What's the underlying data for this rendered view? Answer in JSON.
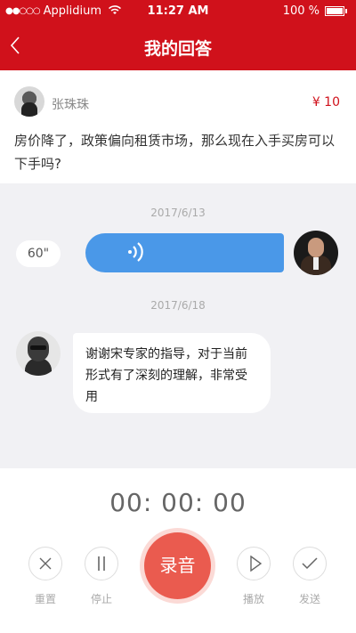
{
  "status_bar": {
    "carrier": "Applidium",
    "time": "11:27 AM",
    "battery": "100 %"
  },
  "nav": {
    "back_icon": "chevron-left-icon",
    "title": "我的回答"
  },
  "question": {
    "asker_name": "张珠珠",
    "price": "¥ 10",
    "text": "房价降了，政策偏向租赁市场，那么现在入手买房可以下手吗?"
  },
  "chat": {
    "date1": "2017/6/13",
    "voice_duration": "60\"",
    "voice_icon": "sound-wave-icon",
    "date2": "2017/6/18",
    "reply_text": "谢谢宋专家的指导，对于当前形式有了深刻的理解，非常受用"
  },
  "recorder": {
    "timer": "00: 00: 00",
    "reset_label": "重置",
    "stop_label": "停止",
    "record_label": "录音",
    "play_label": "播放",
    "send_label": "发送"
  },
  "colors": {
    "brand_red": "#d0111b",
    "voice_blue": "#4a98e8",
    "record_coral": "#ea5b4f"
  }
}
